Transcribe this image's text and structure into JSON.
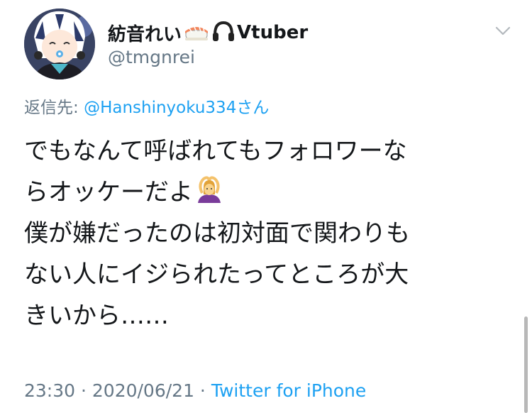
{
  "tweet": {
    "display_name": "紡音れい",
    "name_suffix": "Vtuber",
    "handle": "@tmgnrei",
    "reply_prefix": "返信先: ",
    "reply_mention": "@Hanshinyoku334",
    "reply_suffix": "さん",
    "text_lines": [
      "でもなんて呼ばれてもフォロワーな",
      "らオッケーだよ",
      "僕が嫌だったのは初対面で関わりも",
      "ない人にイジられたってところが大",
      "きいから……"
    ],
    "time": "23:30",
    "separator": " · ",
    "date": "2020/06/21",
    "source": "Twitter for iPhone"
  },
  "icons": {
    "name_emoji_1": "sushi-emoji",
    "name_emoji_2": "headphone-emoji",
    "text_emoji": "person-gesturing-ok-emoji",
    "menu": "chevron-down-icon"
  },
  "colors": {
    "primary_text": "#14171a",
    "secondary_text": "#657786",
    "link": "#1da1f2"
  }
}
